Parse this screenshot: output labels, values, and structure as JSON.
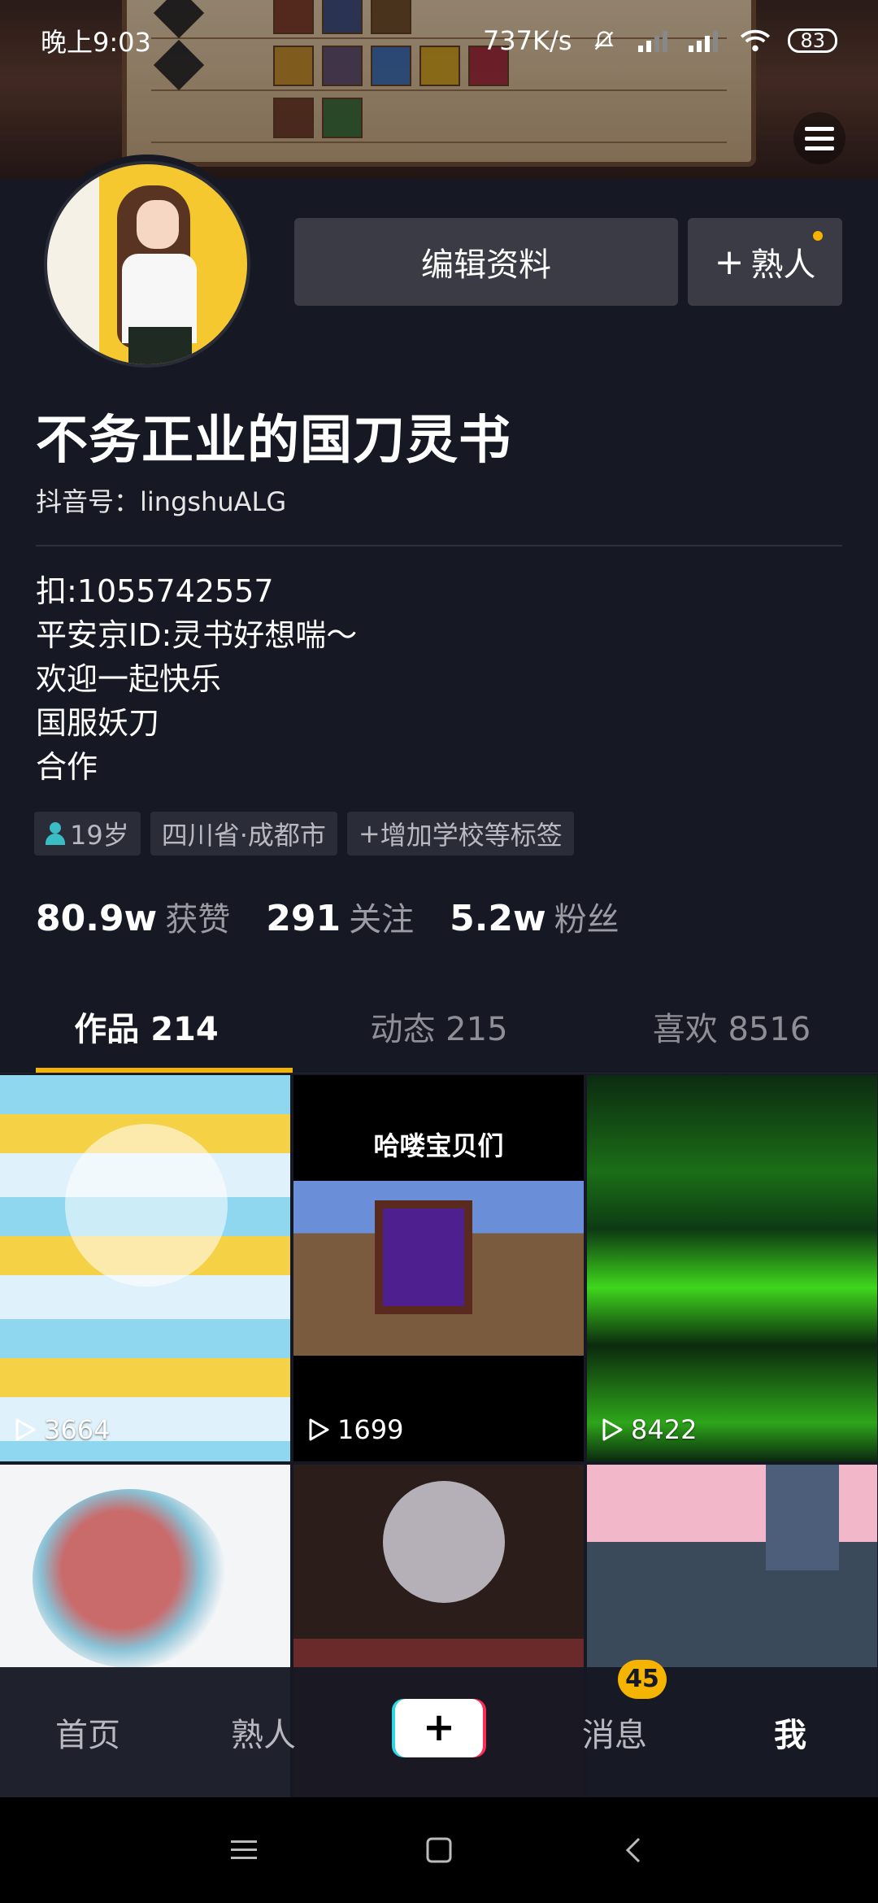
{
  "status_bar": {
    "time": "晚上9:03",
    "net_speed": "737K/s",
    "battery": "83"
  },
  "profile": {
    "nickname": "不务正业的国刀灵书",
    "douyin_id": "抖音号：lingshuALG",
    "edit_button": "编辑资料",
    "add_friend_button": "熟人",
    "bio_lines": [
      "扣:1055742557",
      "平安京ID:灵书好想喘〜",
      "欢迎一起快乐",
      "国服妖刀",
      "合作"
    ],
    "tags": {
      "age": "19岁",
      "location": "四川省·成都市",
      "add_school": "增加学校等标签"
    },
    "stats": {
      "likes_num": "80.9w",
      "likes_label": "获赞",
      "following_num": "291",
      "following_label": "关注",
      "fans_num": "5.2w",
      "fans_label": "粉丝"
    }
  },
  "tabs": [
    {
      "label": "作品 214"
    },
    {
      "label": "动态 215"
    },
    {
      "label": "喜欢 8516"
    }
  ],
  "videos": [
    {
      "views": "3664"
    },
    {
      "views": "1699",
      "title": "哈喽宝贝们"
    },
    {
      "views": "8422"
    },
    {
      "views": ""
    },
    {
      "views": ""
    },
    {
      "views": ""
    }
  ],
  "bottom_nav": {
    "home": "首页",
    "friends": "熟人",
    "create": "+",
    "messages": "消息",
    "messages_badge": "45",
    "me": "我"
  },
  "colors": {
    "background": "#161823",
    "accent": "#f5b400",
    "button": "#3a3b45"
  }
}
